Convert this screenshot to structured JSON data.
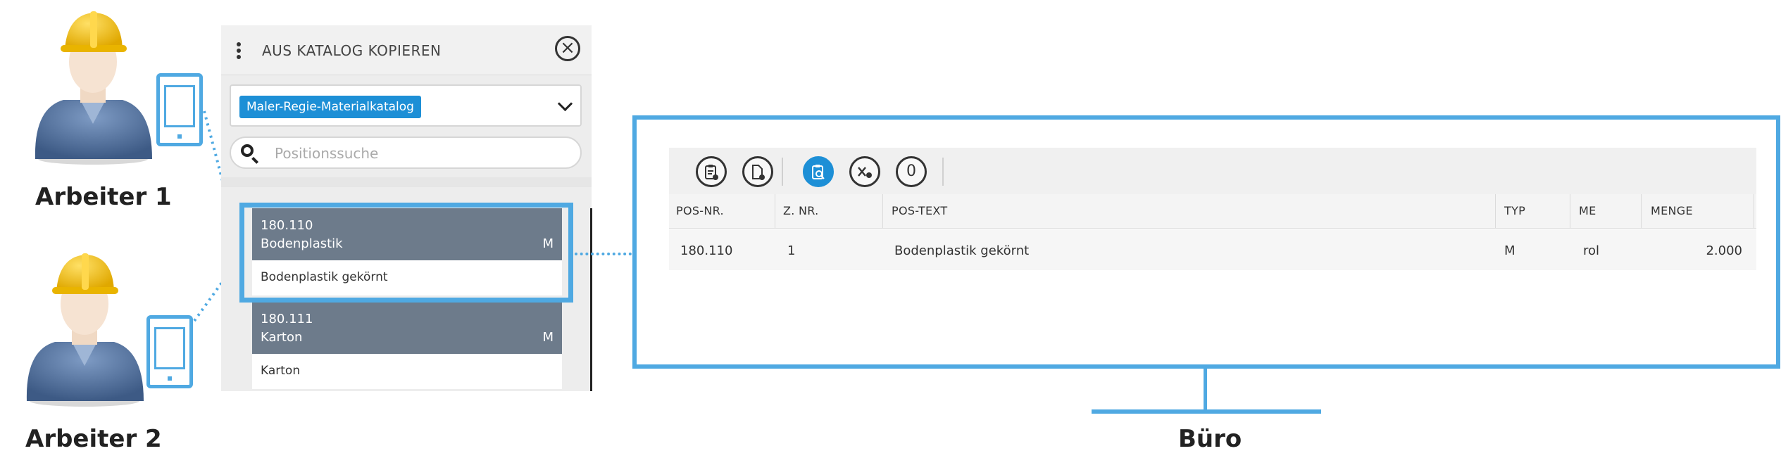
{
  "workers": [
    {
      "label": "Arbeiter 1"
    },
    {
      "label": "Arbeiter 2"
    }
  ],
  "catalog_panel": {
    "title": "AUS KATALOG KOPIEREN",
    "catalog_selected": "Maler-Regie-Materialkatalog",
    "search_placeholder": "Positionssuche",
    "items": [
      {
        "code": "180.110",
        "name": "Bodenplastik",
        "typ": "M",
        "description": "Bodenplastik gekörnt"
      },
      {
        "code": "180.111",
        "name": "Karton",
        "typ": "M",
        "description": "Karton"
      }
    ]
  },
  "office": {
    "label": "Büro",
    "toolbar": {
      "counter": "0"
    },
    "table": {
      "columns": [
        "POS-NR.",
        "Z. NR.",
        "POS-TEXT",
        "TYP",
        "ME",
        "MENGE"
      ],
      "rows": [
        {
          "pos_nr": "180.110",
          "z_nr": "1",
          "pos_text": "Bodenplastik gekörnt",
          "typ": "M",
          "me": "rol",
          "menge": "2.000"
        }
      ]
    }
  },
  "colors": {
    "accent": "#4fa9e2",
    "chip": "#1d8fd6",
    "item_header": "#6d7b8b"
  }
}
